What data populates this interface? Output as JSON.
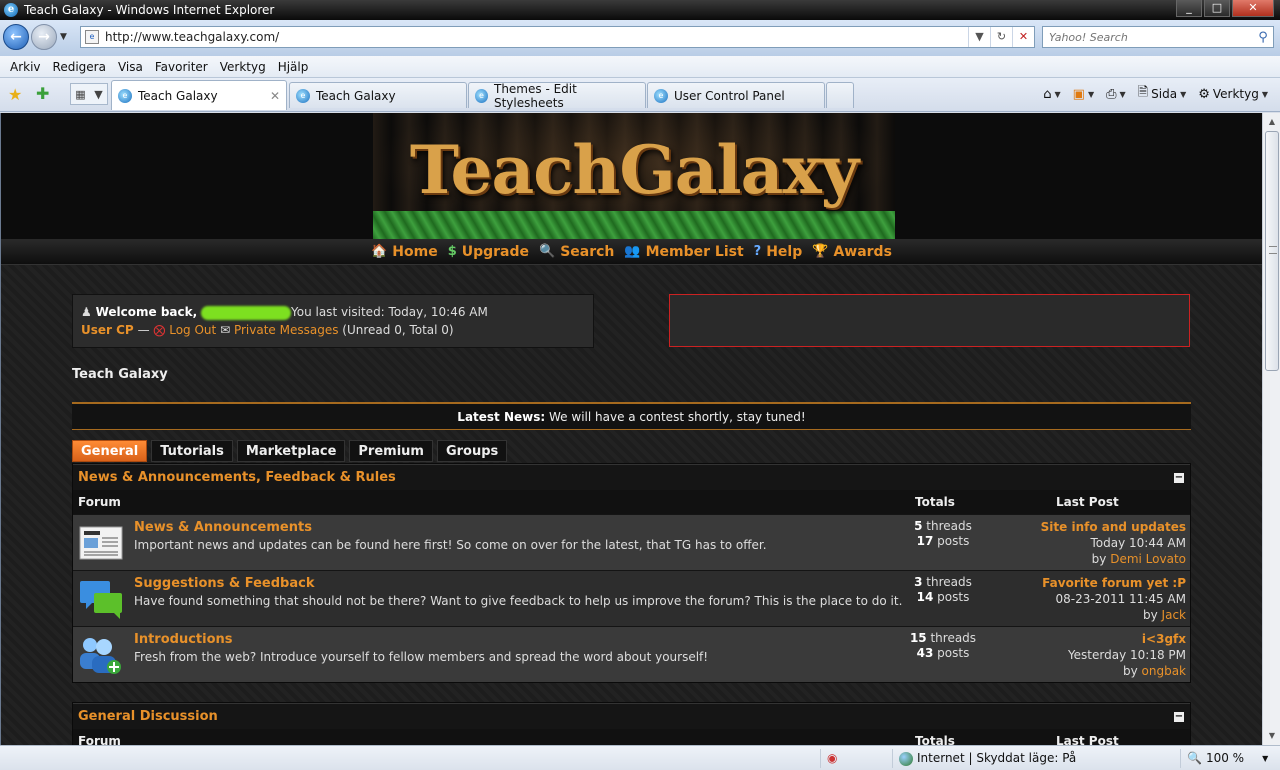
{
  "window": {
    "title": "Teach Galaxy - Windows Internet Explorer",
    "controls": {
      "minimize": "_",
      "maximize": "□",
      "close": "✕"
    }
  },
  "address": {
    "url": "http://www.teachgalaxy.com/",
    "search_placeholder": "Yahoo! Search"
  },
  "menu": {
    "items": [
      "Arkiv",
      "Redigera",
      "Visa",
      "Favoriter",
      "Verktyg",
      "Hjälp"
    ]
  },
  "tabs": [
    {
      "label": "Teach Galaxy",
      "active": true
    },
    {
      "label": "Teach Galaxy",
      "active": false
    },
    {
      "label": "Themes - Edit Stylesheets",
      "active": false
    },
    {
      "label": "User Control Panel",
      "active": false
    }
  ],
  "commandbar": {
    "page_label": "Sida",
    "tools_label": "Verktyg"
  },
  "site": {
    "logo_text": "TeachGalaxy",
    "nav": [
      {
        "label": "Home",
        "icon": "home-icon",
        "glyph": "🏠"
      },
      {
        "label": "Upgrade",
        "icon": "dollar-icon",
        "glyph": "$"
      },
      {
        "label": "Search",
        "icon": "search-icon",
        "glyph": "🔍"
      },
      {
        "label": "Member List",
        "icon": "members-icon",
        "glyph": "👥"
      },
      {
        "label": "Help",
        "icon": "help-icon",
        "glyph": "?"
      },
      {
        "label": "Awards",
        "icon": "awards-icon",
        "glyph": "🏆"
      }
    ],
    "welcome": {
      "prefix": "Welcome back,",
      "last_visit": "You last visited: Today, 10:46 AM",
      "user_cp": "User CP",
      "separator": "—",
      "logout": "Log Out",
      "pm": "Private Messages",
      "pm_counts": "(Unread 0, Total 0)"
    },
    "breadcrumb": "Teach Galaxy",
    "news": {
      "label": "Latest News:",
      "text": "We will have a contest shortly, stay tuned!"
    },
    "forum_tabs": [
      "General",
      "Tutorials",
      "Marketplace",
      "Premium",
      "Groups"
    ],
    "categories": [
      {
        "title": "News & Announcements, Feedback & Rules",
        "collapse": "−",
        "headers": {
          "forum": "Forum",
          "totals": "Totals",
          "last_post": "Last Post"
        },
        "forums": [
          {
            "title": "News & Announcements",
            "desc": "Important news and updates can be found here first! So come on over for the latest, that TG has to offer.",
            "threads": "5",
            "posts": "17",
            "last_title": "Site info and updates",
            "last_time": "Today 10:44 AM",
            "last_by": "Demi Lovato",
            "icon": "newspaper-icon"
          },
          {
            "title": "Suggestions & Feedback",
            "desc": "Have found something that should not be there? Want to give feedback to help us improve the forum? This is the place to do it.",
            "threads": "3",
            "posts": "14",
            "last_title": "Favorite forum yet :P",
            "last_time": "08-23-2011 11:45 AM",
            "last_by": "Jack",
            "icon": "speech-bubbles-icon"
          },
          {
            "title": "Introductions",
            "desc": "Fresh from the web? Introduce yourself to fellow members and spread the word about yourself!",
            "threads": "15",
            "posts": "43",
            "last_title": "i<3gfx",
            "last_time": "Yesterday 10:18 PM",
            "last_by": "ongbak",
            "icon": "add-user-icon"
          }
        ]
      },
      {
        "title": "General Discussion",
        "collapse": "−",
        "headers": {
          "forum": "Forum",
          "totals": "Totals",
          "last_post": "Last Post"
        }
      }
    ],
    "labels": {
      "threads": "threads",
      "posts": "posts",
      "by": "by"
    }
  },
  "status": {
    "zone": "Internet | Skyddat läge: På",
    "zoom": "100 %"
  }
}
